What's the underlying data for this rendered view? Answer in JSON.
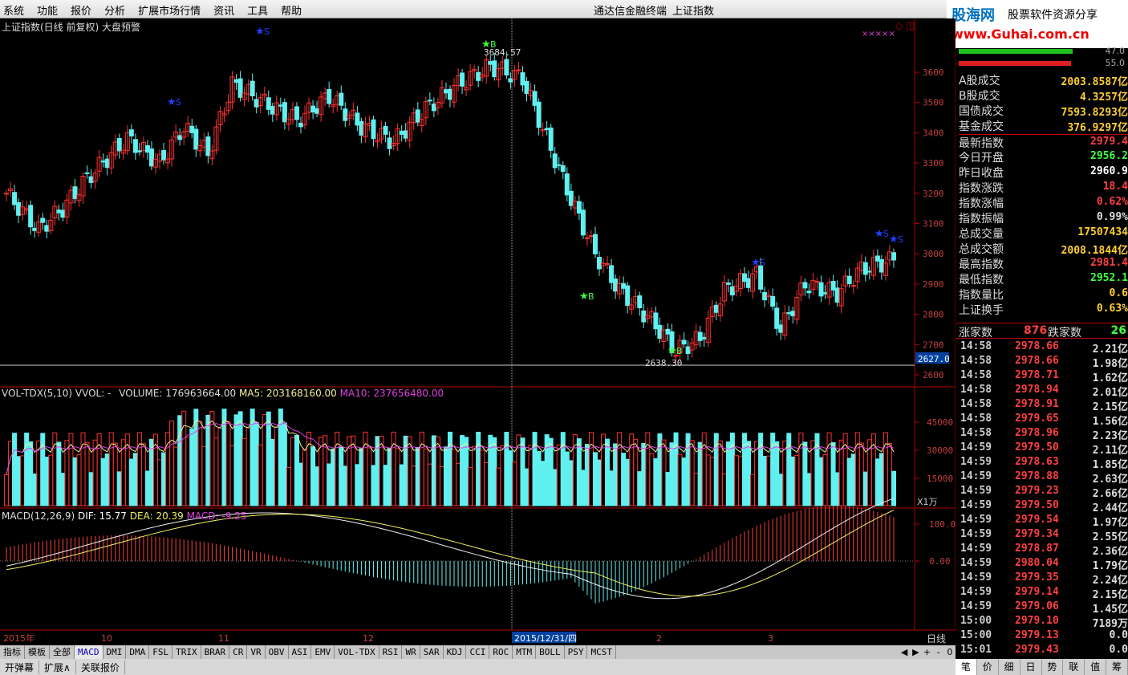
{
  "app": {
    "menu": [
      "系统",
      "功能",
      "报价",
      "分析",
      "扩展市场行情",
      "资讯",
      "工具",
      "帮助"
    ],
    "app_title": "通达信金融终端",
    "doc_title": "上证指数"
  },
  "logo": {
    "name": "股海网",
    "slogan": "股票软件资源分享",
    "url": "www.Guhai.com.cn"
  },
  "chart": {
    "title": "上证指数(日线 前复权) 大盘预警",
    "price_axis": [
      "3600",
      "3500",
      "3400",
      "3300",
      "3200",
      "3100",
      "3000",
      "2900",
      "2800",
      "2700",
      "2600"
    ],
    "current_price_tag": "2627.0",
    "high_label": "3684.57",
    "low_label": "2638.30",
    "markers": {
      "buy": "B",
      "sell": "S"
    },
    "x_labels": [
      "2015年",
      "10",
      "11",
      "12",
      "2015/12/31/四",
      "2",
      "3"
    ],
    "x_right_label": "日线",
    "vol_header": {
      "name": "VOL-TDX(5,10)",
      "vvol": "VVOL: -",
      "volume": "VOLUME: 176963664.00",
      "ma5": "MA5: 203168160.00",
      "ma10": "MA10: 237656480.00"
    },
    "vol_axis": [
      "45000",
      "30000",
      "15000"
    ],
    "vol_unit": "X1万",
    "macd_header": {
      "name": "MACD(12,26,9)",
      "dif": "DIF: 15.77",
      "dea": "DEA: 20.39",
      "macd": "MACD: -9.25"
    },
    "macd_axis": [
      "100.0",
      "0.00"
    ]
  },
  "chart_data": {
    "type": "candlestick",
    "title": "上证指数(日线 前复权)",
    "x_range": [
      "2015-09",
      "2016-03"
    ],
    "price_ylim": [
      2600,
      3700
    ],
    "close_approx": [
      3200,
      3050,
      3100,
      3150,
      3200,
      3300,
      3400,
      3350,
      3250,
      3400,
      3550,
      3650,
      3600,
      3500,
      3450,
      3550,
      3680,
      3600,
      3300,
      2950,
      2850,
      2900,
      3000,
      2800,
      2700,
      2650,
      2750,
      2850,
      2900,
      2950,
      2800,
      2850,
      2900,
      3000,
      2980,
      2979.43
    ],
    "last_close": 2979.43,
    "high": 3684.57,
    "low": 2638.3
  },
  "right_panel": {
    "ratio_labels": [
      "47.0",
      "55.0"
    ],
    "stats": [
      {
        "label": "A股成交",
        "value": "2003.8587亿",
        "color": "#ffd030"
      },
      {
        "label": "B股成交",
        "value": "4.3257亿",
        "color": "#ffd030"
      },
      {
        "label": "国债成交",
        "value": "7593.8293亿",
        "color": "#ffd030"
      },
      {
        "label": "基金成交",
        "value": "376.9297亿",
        "color": "#ffd030"
      },
      {
        "label": "最新指数",
        "value": "2979.4",
        "color": "#ff4040"
      },
      {
        "label": "今日开盘",
        "value": "2956.2",
        "color": "#40ff40"
      },
      {
        "label": "昨日收盘",
        "value": "2960.9",
        "color": "#ffffff"
      },
      {
        "label": "指数涨跌",
        "value": "18.4",
        "color": "#ff4040"
      },
      {
        "label": "指数涨幅",
        "value": "0.62%",
        "color": "#ff4040"
      },
      {
        "label": "指数振幅",
        "value": "0.99%",
        "color": "#dddddd"
      },
      {
        "label": "总成交量",
        "value": "17507434",
        "color": "#ffd030"
      },
      {
        "label": "总成交额",
        "value": "2008.1844亿",
        "color": "#ffd030"
      },
      {
        "label": "最高指数",
        "value": "2981.4",
        "color": "#ff4040"
      },
      {
        "label": "最低指数",
        "value": "2952.1",
        "color": "#40ff40"
      },
      {
        "label": "指数量比",
        "value": "0.6",
        "color": "#ffd030"
      },
      {
        "label": "上证换手",
        "value": "0.63%",
        "color": "#ffd030"
      }
    ],
    "updown": {
      "up_label": "涨家数",
      "up": "876",
      "down_label": "跌家数",
      "down": "26"
    },
    "ticks": [
      {
        "t": "14:58",
        "p": "2978.66",
        "v": "2.21亿"
      },
      {
        "t": "14:58",
        "p": "2978.66",
        "v": "1.98亿"
      },
      {
        "t": "14:58",
        "p": "2978.71",
        "v": "1.62亿"
      },
      {
        "t": "14:58",
        "p": "2978.94",
        "v": "2.01亿"
      },
      {
        "t": "14:58",
        "p": "2978.91",
        "v": "2.15亿"
      },
      {
        "t": "14:58",
        "p": "2979.65",
        "v": "1.56亿"
      },
      {
        "t": "14:58",
        "p": "2978.96",
        "v": "2.23亿"
      },
      {
        "t": "14:59",
        "p": "2979.50",
        "v": "2.11亿"
      },
      {
        "t": "14:59",
        "p": "2978.63",
        "v": "1.85亿"
      },
      {
        "t": "14:59",
        "p": "2978.88",
        "v": "2.63亿"
      },
      {
        "t": "14:59",
        "p": "2979.23",
        "v": "2.66亿"
      },
      {
        "t": "14:59",
        "p": "2979.50",
        "v": "2.44亿"
      },
      {
        "t": "14:59",
        "p": "2979.54",
        "v": "1.97亿"
      },
      {
        "t": "14:59",
        "p": "2979.34",
        "v": "2.55亿"
      },
      {
        "t": "14:59",
        "p": "2978.87",
        "v": "2.36亿"
      },
      {
        "t": "14:59",
        "p": "2980.04",
        "v": "1.79亿"
      },
      {
        "t": "14:59",
        "p": "2979.35",
        "v": "2.24亿"
      },
      {
        "t": "14:59",
        "p": "2979.14",
        "v": "2.15亿"
      },
      {
        "t": "14:59",
        "p": "2979.06",
        "v": "1.45亿"
      },
      {
        "t": "15:00",
        "p": "2979.10",
        "v": "7189万"
      },
      {
        "t": "15:00",
        "p": "2979.13",
        "v": "0.0"
      },
      {
        "t": "15:01",
        "p": "2979.43",
        "v": "0.0"
      }
    ]
  },
  "indicator_tabs": [
    "指标",
    "模板",
    "全部",
    "MACD",
    "DMI",
    "DMA",
    "FSL",
    "TRIX",
    "BRAR",
    "CR",
    "VR",
    "OBV",
    "ASI",
    "EMV",
    "VOL-TDX",
    "RSI",
    "WR",
    "SAR",
    "KDJ",
    "CCI",
    "ROC",
    "MTM",
    "BOLL",
    "PSY",
    "MCST"
  ],
  "nav": [
    "◀",
    "▶",
    "+",
    "-",
    "0"
  ],
  "bottom_bar": [
    "开弹幕",
    "扩展∧",
    "关联报价"
  ],
  "right_tabs": [
    "笔",
    "价",
    "细",
    "日",
    "势",
    "联",
    "值",
    "筹"
  ]
}
